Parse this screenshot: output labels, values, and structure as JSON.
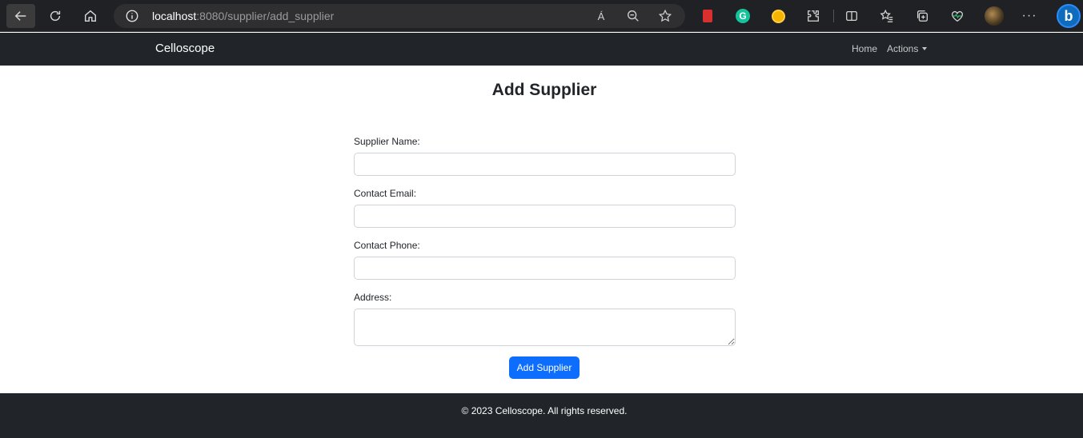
{
  "browser": {
    "url_host": "localhost",
    "url_rest": ":8080/supplier/add_supplier",
    "icons": [
      "back-icon",
      "reload-icon",
      "home-icon",
      "info-icon",
      "read-aloud-icon",
      "zoom-out-icon",
      "favorite-star-icon",
      "extension-bookmark-icon",
      "grammarly-icon",
      "extension-icon",
      "puzzle-icon",
      "split-screen-icon",
      "favorites-icon",
      "collections-icon",
      "health-icon",
      "profile-avatar",
      "more-icon",
      "bing-icon"
    ],
    "read_aloud_glyph": "Á",
    "grammarly_glyph": "G",
    "more_glyph": "···",
    "bing_glyph": "b"
  },
  "navbar": {
    "brand": "Celloscope",
    "home": "Home",
    "actions": "Actions"
  },
  "main": {
    "title": "Add Supplier",
    "fields": [
      {
        "label": "Supplier Name:",
        "value": ""
      },
      {
        "label": "Contact Email:",
        "value": ""
      },
      {
        "label": "Contact Phone:",
        "value": ""
      },
      {
        "label": "Address:",
        "value": ""
      }
    ],
    "submit_label": "Add Supplier"
  },
  "footer": {
    "text": "© 2023 Celloscope. All rights reserved."
  },
  "colors": {
    "navbar_bg": "#212529",
    "primary": "#0d6efd",
    "chrome_bg": "#202124"
  }
}
